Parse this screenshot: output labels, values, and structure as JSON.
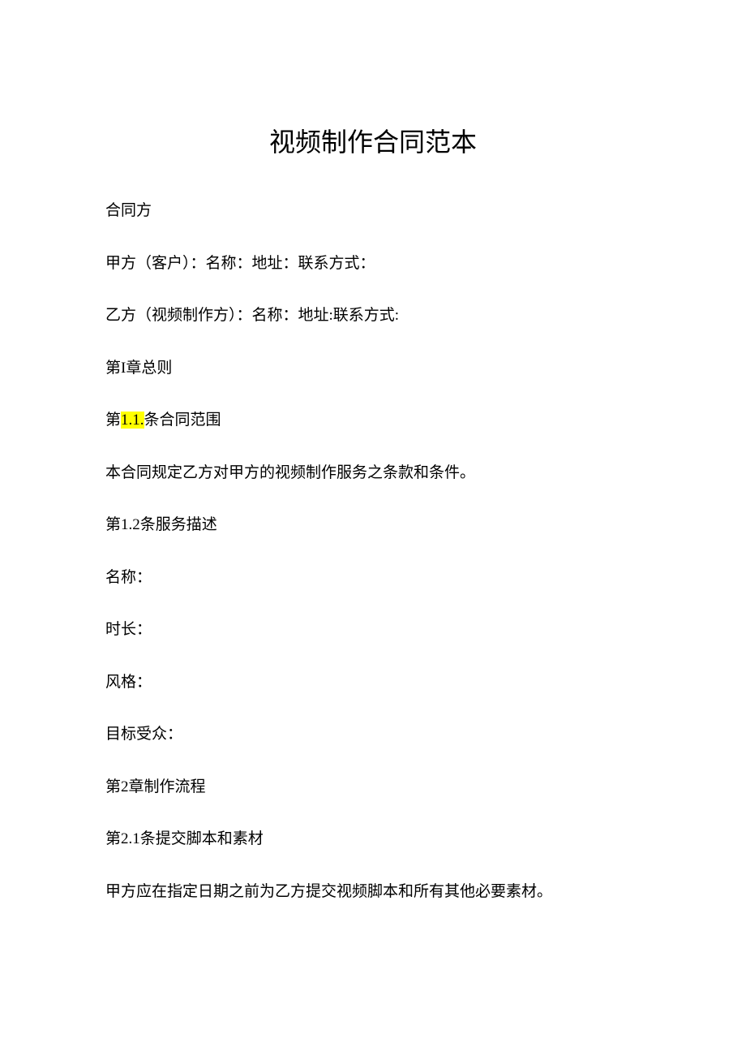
{
  "title": "视频制作合同范本",
  "paragraphs": {
    "p1": "合同方",
    "p2": "甲方（客户）：名称：地址：联系方式：",
    "p3": "乙方（视频制作方）：名称：地址:联系方式:",
    "p4": "第I章总则",
    "p5_prefix": "第",
    "p5_highlight": "1.1.",
    "p5_suffix": "条合同范围",
    "p6": "本合同规定乙方对甲方的视频制作服务之条款和条件。",
    "p7": "第1.2条服务描述",
    "p8": "名称：",
    "p9": "时长：",
    "p10": "风格：",
    "p11": "目标受众：",
    "p12": "第2章制作流程",
    "p13": "第2.1条提交脚本和素材",
    "p14": "甲方应在指定日期之前为乙方提交视频脚本和所有其他必要素材。"
  }
}
